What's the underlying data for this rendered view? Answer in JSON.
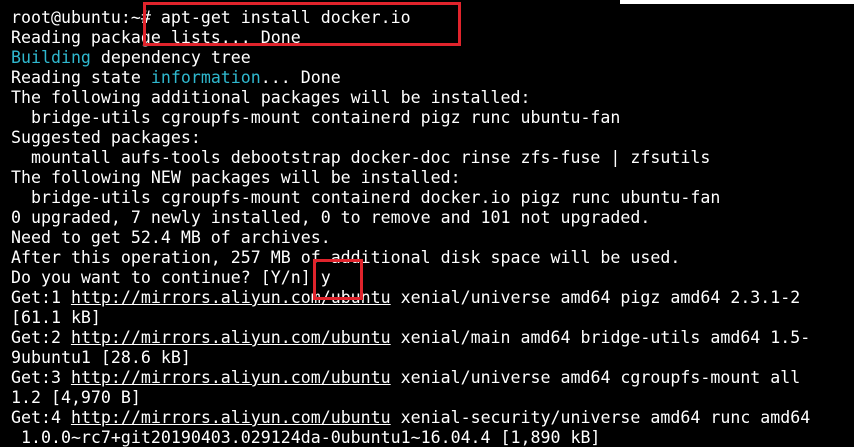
{
  "terminal": {
    "prompt": "root@ubuntu:~#",
    "command": " apt-get install docker.io",
    "lines": {
      "l1": "Reading package lists... Done",
      "l2_a": "Building",
      "l2_b": " dependency tree",
      "l3_a": "Reading state ",
      "l3_b": "information",
      "l3_c": "... Done",
      "l4": "The following additional packages will be installed:",
      "l5": "  bridge-utils cgroupfs-mount containerd pigz runc ubuntu-fan",
      "l6": "Suggested packages:",
      "l7": "  mountall aufs-tools debootstrap docker-doc rinse zfs-fuse | zfsutils",
      "l8": "The following NEW packages will be installed:",
      "l9": "  bridge-utils cgroupfs-mount containerd docker.io pigz runc ubuntu-fan",
      "l10": "0 upgraded, 7 newly installed, 0 to remove and 101 not upgraded.",
      "l11": "Need to get 52.4 MB of archives.",
      "l12": "After this operation, 257 MB of additional disk space will be used.",
      "l13_prompt": "Do you want to continue? [Y/n] ",
      "l13_answer": "y",
      "get1_prefix": "Get:1 ",
      "get1_url": "http://mirrors.aliyun.com/ubuntu",
      "get1_rest": " xenial/universe amd64 pigz amd64 2.3.1-2",
      "get1_cont": "[61.1 kB]",
      "get2_prefix": "Get:2 ",
      "get2_url": "http://mirrors.aliyun.com/ubuntu",
      "get2_rest": " xenial/main amd64 bridge-utils amd64 1.5-",
      "get2_cont": "9ubuntu1 [28.6 kB]",
      "get3_prefix": "Get:3 ",
      "get3_url": "http://mirrors.aliyun.com/ubuntu",
      "get3_rest": " xenial/universe amd64 cgroupfs-mount all",
      "get3_cont": "1.2 [4,970 B]",
      "get4_prefix": "Get:4 ",
      "get4_url": "http://mirrors.aliyun.com/ubuntu",
      "get4_rest": " xenial-security/universe amd64 runc amd64",
      "get4_cont": " 1.0.0~rc7+git20190403.029124da-0ubuntu1~16.04.4 [1,890 kB]"
    }
  },
  "colors": {
    "background": "#000000",
    "text": "#ffffff",
    "cyan": "#2fb8ce",
    "highlight": "#e0242c"
  }
}
